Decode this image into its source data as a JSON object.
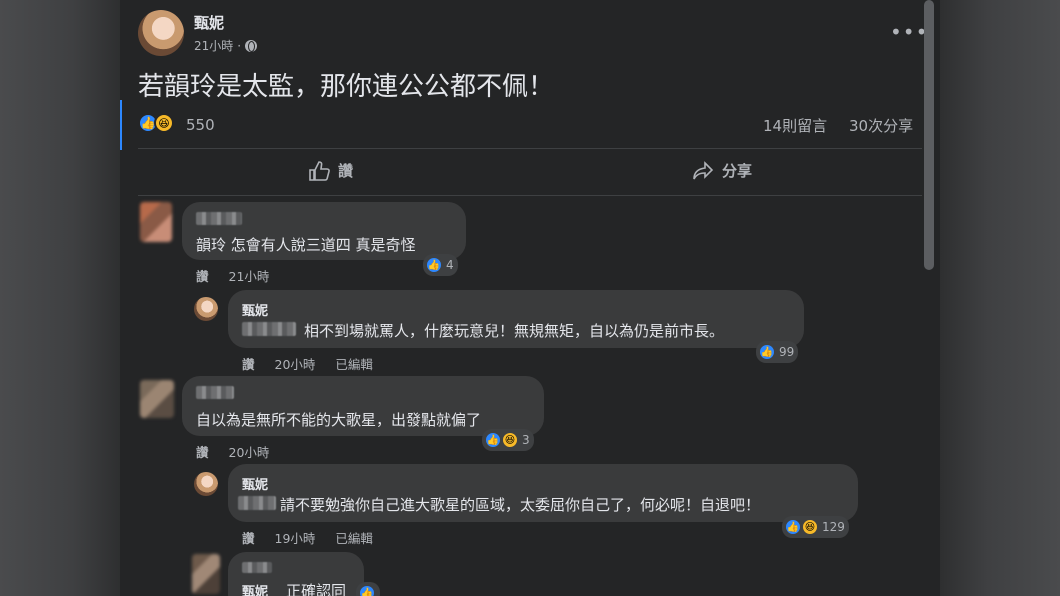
{
  "post": {
    "author": "甄妮",
    "time": "21小時",
    "more": "•••",
    "text": "若韻玲是太監，那你連公公都不佩！",
    "reactions_count": "550",
    "comments_count": "14則留言",
    "shares_count": "30次分享",
    "actions": {
      "like": "讚",
      "share": "分享"
    }
  },
  "icons": {
    "like": "thumbs-up-icon",
    "haha": "haha-icon",
    "globe": "globe-icon",
    "share": "share-arrow-icon"
  },
  "colors": {
    "like_blue": "#2d88ff",
    "haha_yellow": "#f7b928",
    "background": "#242526"
  },
  "comments": [
    {
      "text": "韻玲 怎會有人說三道四 真是奇怪",
      "like": "讚",
      "time": "21小時",
      "reactions": "4"
    },
    {
      "name": "甄妮",
      "text": "相不到場就罵人，什麼玩意兒！無規無矩，自以為仍是前市長。",
      "like": "讚",
      "time": "20小時",
      "edited": "已編輯",
      "reactions": "99"
    },
    {
      "text": "自以為是無所不能的大歌星，出發點就偏了",
      "like": "讚",
      "time": "20小時",
      "reactions": "3"
    },
    {
      "name": "甄妮",
      "text": "請不要勉強你自己進大歌星的區域，太委屈你自己了，何必呢！自退吧！",
      "like": "讚",
      "time": "19小時",
      "edited": "已編輯",
      "reactions": "129"
    },
    {
      "name": "甄妮",
      "text": "正確認同"
    }
  ]
}
